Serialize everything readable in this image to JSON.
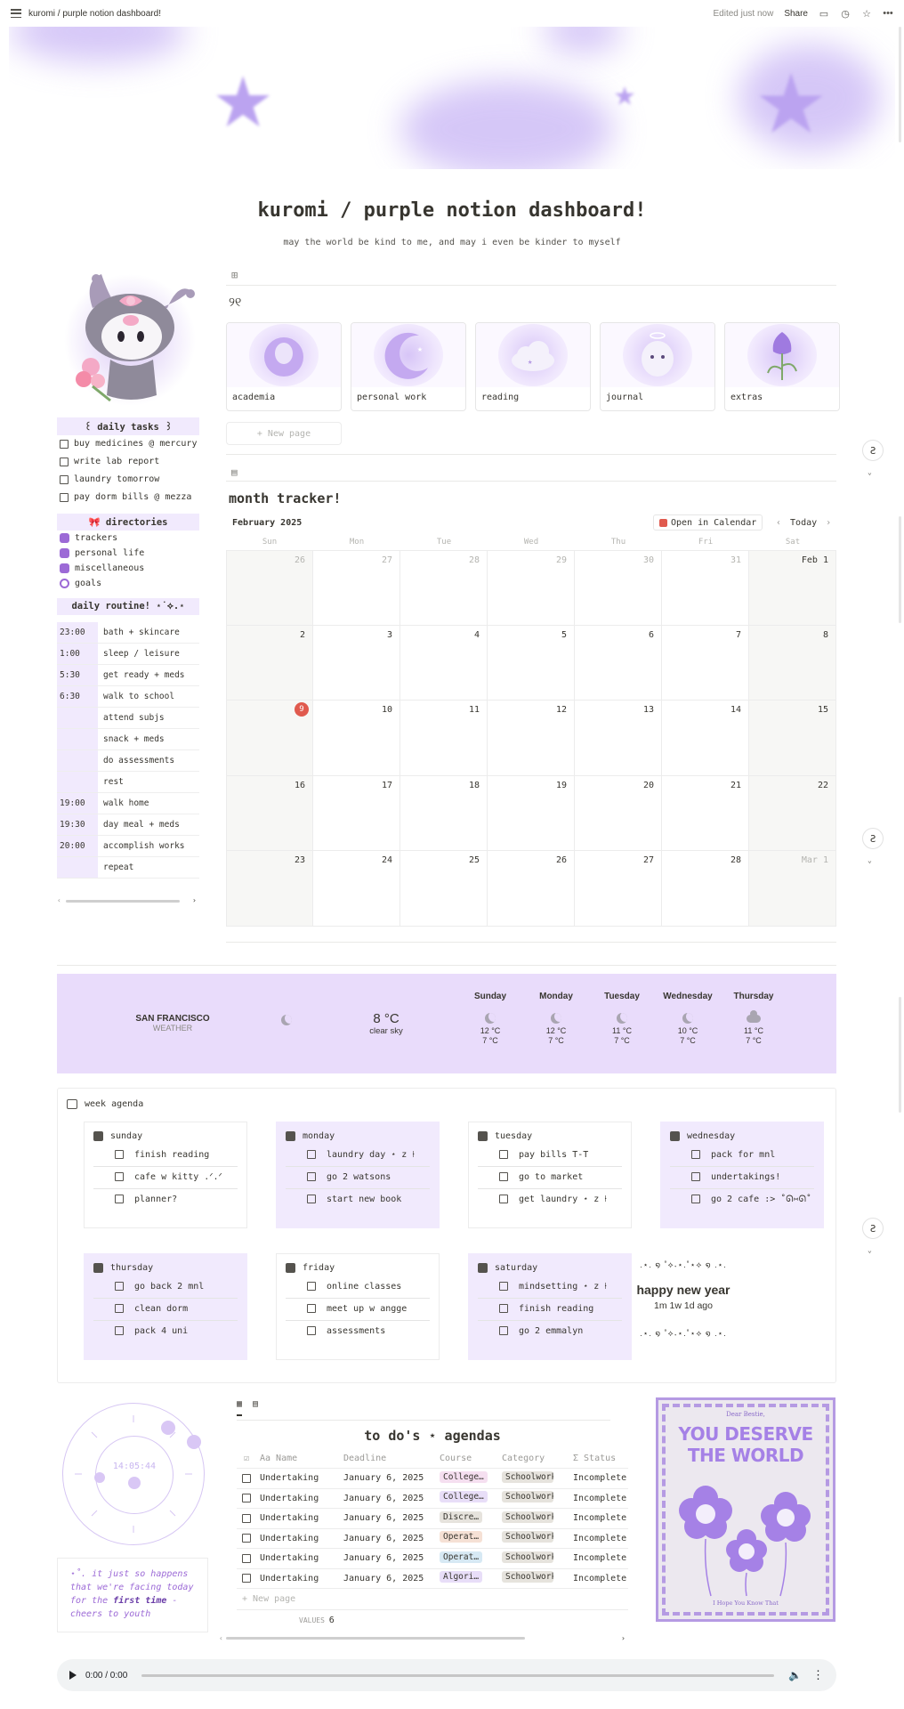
{
  "topbar": {
    "breadcrumb": "kuromi / purple notion dashboard!",
    "edited": "Edited just now",
    "share": "Share"
  },
  "page": {
    "title": "kuromi / purple notion dashboard!",
    "subtitle": "may the world be kind to me, and may i even be kinder to myself"
  },
  "daily_tasks": {
    "heading": "꒰ daily tasks ꒱",
    "items": [
      "buy medicines @ mercury",
      "write lab report",
      "laundry tomorrow",
      "pay dorm bills @ mezza"
    ]
  },
  "directories": {
    "heading": "🎀 directories",
    "items": [
      "trackers",
      "personal life",
      "miscellaneous",
      "goals"
    ]
  },
  "routine": {
    "heading": "daily routine! ⋆˙⟡.⋆",
    "rows": [
      {
        "time": "23:00",
        "task": "bath + skincare"
      },
      {
        "time": "1:00",
        "task": "sleep / leisure"
      },
      {
        "time": "5:30",
        "task": "get ready + meds"
      },
      {
        "time": "6:30",
        "task": "walk to school"
      },
      {
        "time": "",
        "task": "attend subjs"
      },
      {
        "time": "",
        "task": "snack + meds"
      },
      {
        "time": "",
        "task": "do assessments"
      },
      {
        "time": "",
        "task": "rest"
      },
      {
        "time": "19:00",
        "task": "walk home"
      },
      {
        "time": "19:30",
        "task": "day meal + meds"
      },
      {
        "time": "20:00",
        "task": "accomplish works"
      },
      {
        "time": "",
        "task": "repeat"
      }
    ]
  },
  "gallery": {
    "heading": "୨୧",
    "cards": [
      "academia",
      "personal work",
      "reading",
      "journal",
      "extras"
    ],
    "new_page": "+ New page"
  },
  "calendar": {
    "title": "month tracker!",
    "month": "February 2025",
    "open_in_calendar": "Open in Calendar",
    "today": "Today",
    "weekdays": [
      "Sun",
      "Mon",
      "Tue",
      "Wed",
      "Thu",
      "Fri",
      "Sat"
    ],
    "weeks": [
      [
        "26",
        "27",
        "28",
        "29",
        "30",
        "31",
        "Feb 1"
      ],
      [
        "2",
        "3",
        "4",
        "5",
        "6",
        "7",
        "8"
      ],
      [
        "9",
        "10",
        "11",
        "12",
        "13",
        "14",
        "15"
      ],
      [
        "16",
        "17",
        "18",
        "19",
        "20",
        "21",
        "22"
      ],
      [
        "23",
        "24",
        "25",
        "26",
        "27",
        "28",
        "Mar 1"
      ]
    ],
    "today_date": "9"
  },
  "weather": {
    "city": "SAN FRANCISCO",
    "label": "WEATHER",
    "current_temp": "8 °C",
    "current_desc": "clear sky",
    "days": [
      {
        "name": "Sunday",
        "icon": "moon-icon",
        "hi": "12 °C",
        "lo": "7 °C"
      },
      {
        "name": "Monday",
        "icon": "moon-icon",
        "hi": "12 °C",
        "lo": "7 °C"
      },
      {
        "name": "Tuesday",
        "icon": "cloud-moon-icon",
        "hi": "11 °C",
        "lo": "7 °C"
      },
      {
        "name": "Wednesday",
        "icon": "moon-icon",
        "hi": "10 °C",
        "lo": "7 °C"
      },
      {
        "name": "Thursday",
        "icon": "cloud-icon",
        "hi": "11 °C",
        "lo": "7 °C"
      }
    ]
  },
  "agenda": {
    "title": "week agenda",
    "days": [
      {
        "name": "sunday",
        "items": [
          "finish reading",
          "cafe w kitty .ᐟ.ᐟ",
          "planner?"
        ]
      },
      {
        "name": "monday",
        "items": [
          "laundry day ⋆ z ⍿",
          "go 2 watsons",
          "start new book"
        ]
      },
      {
        "name": "tuesday",
        "items": [
          "pay bills T-T",
          "go to market",
          "get laundry ⋆ z ⍿"
        ]
      },
      {
        "name": "wednesday",
        "items": [
          "pack for mnl",
          "undertakings!",
          "go 2 cafe :> ˚ᘏ⑅ᘏ˚"
        ]
      },
      {
        "name": "thursday",
        "items": [
          "go back 2 mnl",
          "clean dorm",
          "pack 4 uni"
        ]
      },
      {
        "name": "friday",
        "items": [
          "online classes",
          "meet up w angge",
          "assessments"
        ]
      },
      {
        "name": "saturday",
        "items": [
          "mindsetting ⋆ z ⍿",
          "finish reading",
          "go 2 emmalyn"
        ]
      }
    ],
    "newyear": {
      "deco": ".⋆. ໑ ˚⟡˖⋆.˚⋆⟡ ໑ .⋆.",
      "title": "happy new year",
      "ago": "1m 1w 1d ago"
    }
  },
  "clock": {
    "time": "14:05:44"
  },
  "quote": {
    "before": "⋆˚. it just so happens that we're facing today for the ",
    "bold": "first time",
    "after": " - cheers to youth"
  },
  "table": {
    "title": "to do's ⋆ agendas",
    "headers": [
      "Aa Name",
      "Deadline",
      "Course",
      "Category",
      "Σ Status"
    ],
    "rows": [
      {
        "name": "Undertaking",
        "deadline": "January 6, 2025",
        "course": "College…",
        "course_color": "#f5dff0",
        "category": "Schoolwork",
        "status": "Incomplete"
      },
      {
        "name": "Undertaking",
        "deadline": "January 6, 2025",
        "course": "College…",
        "course_color": "#e8def8",
        "category": "Schoolwork",
        "status": "Incomplete"
      },
      {
        "name": "Undertaking",
        "deadline": "January 6, 2025",
        "course": "Discre…",
        "course_color": "#e6e3dd",
        "category": "Schoolwork",
        "status": "Incomplete"
      },
      {
        "name": "Undertaking",
        "deadline": "January 6, 2025",
        "course": "Operat…",
        "course_color": "#f6e1d5",
        "category": "Schoolwork",
        "status": "Incomplete"
      },
      {
        "name": "Undertaking",
        "deadline": "January 6, 2025",
        "course": "Operat…",
        "course_color": "#d7e9f4",
        "category": "Schoolwork",
        "status": "Incomplete"
      },
      {
        "name": "Undertaking",
        "deadline": "January 6, 2025",
        "course": "Algori…",
        "course_color": "#e8def8",
        "category": "Schoolwork",
        "status": "Incomplete"
      }
    ],
    "new_page": "+ New page",
    "count_label": "VALUES",
    "count": "6"
  },
  "poster": {
    "top": "Dear Bestie,",
    "big": "YOU DESERVE THE WORLD",
    "bottom": "I Hope You Know That"
  },
  "audio": {
    "time": "0:00 / 0:00"
  },
  "colors": {
    "accent": "#9c6ad6",
    "lavender": "#e9dcfb",
    "today_red": "#e05a4e"
  }
}
